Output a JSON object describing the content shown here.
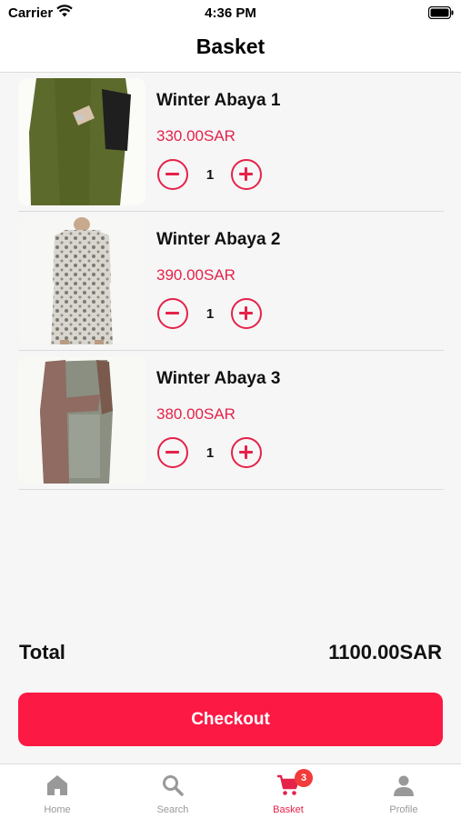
{
  "status_bar": {
    "carrier": "Carrier",
    "time": "4:36 PM"
  },
  "header": {
    "title": "Basket"
  },
  "items": [
    {
      "name": "Winter Abaya 1",
      "price": "330.00SAR",
      "quantity": "1",
      "image": "olive-abaya"
    },
    {
      "name": "Winter Abaya 2",
      "price": "390.00SAR",
      "quantity": "1",
      "image": "printed-abaya"
    },
    {
      "name": "Winter Abaya 3",
      "price": "380.00SAR",
      "quantity": "1",
      "image": "grey-brown-abaya"
    }
  ],
  "summary": {
    "total_label": "Total",
    "total_value": "1100.00SAR"
  },
  "checkout": {
    "label": "Checkout"
  },
  "tabs": [
    {
      "label": "Home",
      "icon": "home-icon"
    },
    {
      "label": "Search",
      "icon": "search-icon"
    },
    {
      "label": "Basket",
      "icon": "cart-icon",
      "badge": "3",
      "active": true
    },
    {
      "label": "Profile",
      "icon": "person-icon"
    }
  ],
  "colors": {
    "accent": "#e5224a",
    "checkout": "#fc1944",
    "badge": "#f23b3b",
    "inactive_tab": "#999999"
  }
}
